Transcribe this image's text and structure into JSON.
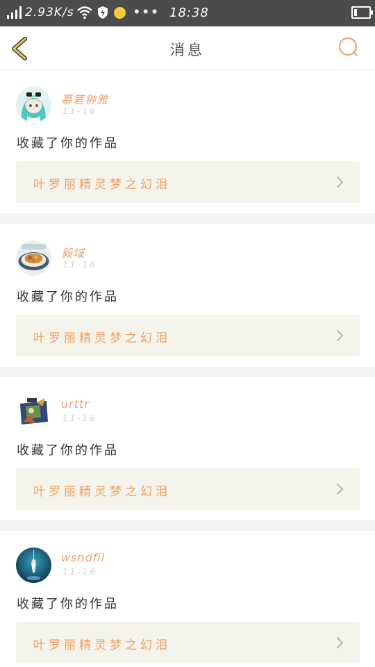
{
  "status_bar": {
    "speed": "2.93K/s",
    "time": "18:38",
    "more": "•••",
    "battery_level": 0.2,
    "colors": {
      "background": "#4b4b4b",
      "dot": "#f6cc3a"
    }
  },
  "header": {
    "title": "消息",
    "back_icon": "chevron-left-icon",
    "search_icon": "search-icon",
    "colors": {
      "back": "#e8c84a",
      "search": "#f2a07a"
    }
  },
  "notifications": [
    {
      "username": "慕箬翀雅",
      "date": "11-16",
      "action": "收藏了你的作品",
      "work_title": "叶罗丽精灵梦之幻泪",
      "avatar": "anime-girl-avatar"
    },
    {
      "username": "毅域",
      "date": "11-16",
      "action": "收藏了你的作品",
      "work_title": "叶罗丽精灵梦之幻泪",
      "avatar": "food-plate-avatar"
    },
    {
      "username": "urttr",
      "date": "11-16",
      "action": "收藏了你的作品",
      "work_title": "叶罗丽精灵梦之幻泪",
      "avatar": "character-avatar"
    },
    {
      "username": "wsndfll",
      "date": "11-16",
      "action": "收藏了你的作品",
      "work_title": "叶罗丽精灵梦之幻泪",
      "avatar": "underwater-avatar"
    }
  ],
  "colors": {
    "accent": "#f0a070",
    "work_box_bg": "#f4f3ec",
    "page_bg": "#f4f4f4"
  }
}
